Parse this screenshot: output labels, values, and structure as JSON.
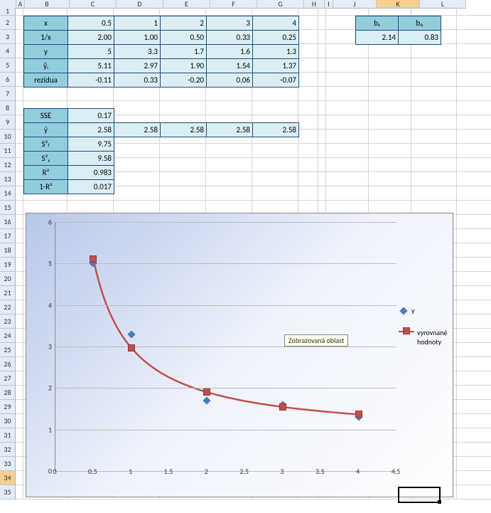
{
  "columns": [
    "A",
    "B",
    "C",
    "D",
    "E",
    "F",
    "G",
    "H",
    "I",
    "J",
    "K",
    "L"
  ],
  "rows": [
    "1",
    "2",
    "3",
    "4",
    "5",
    "6",
    "7",
    "8",
    "9",
    "10",
    "11",
    "12",
    "13",
    "14",
    "15",
    "16",
    "17",
    "18",
    "19",
    "20",
    "21",
    "22",
    "23",
    "24",
    "25",
    "26",
    "27",
    "28",
    "29",
    "30",
    "31",
    "32",
    "33",
    "34",
    "35"
  ],
  "selected_col": "K",
  "selected_row": "34",
  "table1": {
    "headers": [
      "x",
      "1/x",
      "y",
      "ŷᵢ",
      "rezidua"
    ],
    "data": [
      [
        "0.5",
        "1",
        "2",
        "3",
        "4"
      ],
      [
        "2.00",
        "1.00",
        "0.50",
        "0.33",
        "0.25"
      ],
      [
        "5",
        "3.3",
        "1.7",
        "1.6",
        "1.3"
      ],
      [
        "5.11",
        "2.97",
        "1.90",
        "1.54",
        "1.37"
      ],
      [
        "-0.11",
        "0.33",
        "-0.20",
        "0.06",
        "-0.07"
      ]
    ]
  },
  "coeffs": {
    "h": [
      "b₁",
      "b₀"
    ],
    "v": [
      "2.14",
      "0.83"
    ]
  },
  "stats": {
    "rows": [
      "SSE",
      "ȳ",
      "S²ₜ",
      "S²ᵧ",
      "R²",
      "1-R²"
    ],
    "vals": [
      "0.17",
      "2.58",
      "9.75",
      "9.58",
      "0.983",
      "0.017"
    ],
    "ybar_extra": [
      "2.58",
      "2.58",
      "2.58",
      "2.58"
    ]
  },
  "tooltip": "Zobrazovaná oblast",
  "legend": {
    "s1": "y",
    "s2a": "vyrovnané",
    "s2b": "hodnoty"
  },
  "chart_data": {
    "type": "scatter",
    "xlim": [
      0,
      4.5
    ],
    "ylim": [
      0,
      6
    ],
    "xticks": [
      "0",
      "0.5",
      "1",
      "1.5",
      "2",
      "2.5",
      "3",
      "3.5",
      "4",
      "4.5"
    ],
    "yticks": [
      "0",
      "1",
      "2",
      "3",
      "4",
      "5",
      "6"
    ],
    "series": [
      {
        "name": "y",
        "type": "points",
        "marker": "diamond",
        "color": "#4a7ebb",
        "x": [
          0.5,
          1,
          2,
          3,
          4
        ],
        "y": [
          5,
          3.3,
          1.7,
          1.6,
          1.3
        ]
      },
      {
        "name": "vyrovnané hodnoty",
        "type": "line+points",
        "marker": "square",
        "color": "#c0504d",
        "x": [
          0.5,
          1,
          2,
          3,
          4
        ],
        "y": [
          5.11,
          2.97,
          1.9,
          1.54,
          1.37
        ]
      }
    ]
  }
}
